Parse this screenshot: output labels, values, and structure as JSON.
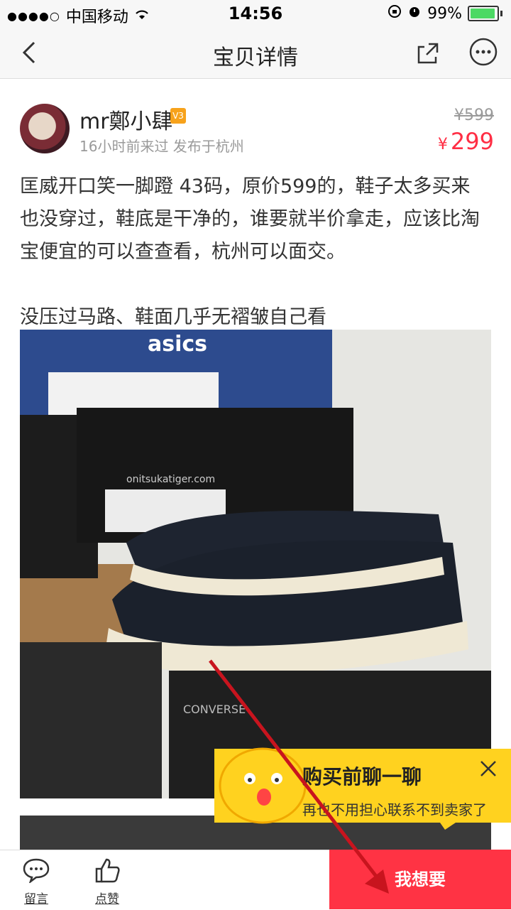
{
  "status_bar": {
    "carrier": "中国移动",
    "time": "14:56",
    "battery": "99%"
  },
  "nav": {
    "title": "宝贝详情"
  },
  "seller": {
    "name": "mr鄭小肆",
    "level": "V3",
    "meta": "16小时前来过 发布于杭州"
  },
  "price": {
    "original": "¥599",
    "currency": "¥",
    "current": "299"
  },
  "description": {
    "para1": "匡威开口笑一脚蹬 43码，原价599的，鞋子太多买来也没穿过，鞋底是干净的，谁要就半价拿走，应该比淘宝便宜的可以查查看，杭州可以面交。",
    "para2": "没压过马路、鞋面几乎无褶皱自己看"
  },
  "photo": {
    "box_brand_top": "asics",
    "box_brand_mid": "onitsukatiger.com",
    "box_brand_bottom": "CONVERSE"
  },
  "promo": {
    "title": "购买前聊一聊",
    "subtitle": "再也不用担心联系不到卖家了"
  },
  "bottom": {
    "comment_label": "留言",
    "like_label": "点赞",
    "want_label": "我想要"
  },
  "colors": {
    "accent_red": "#ff3344",
    "price_red": "#ff2e44",
    "promo_yellow": "#ffd21f"
  }
}
